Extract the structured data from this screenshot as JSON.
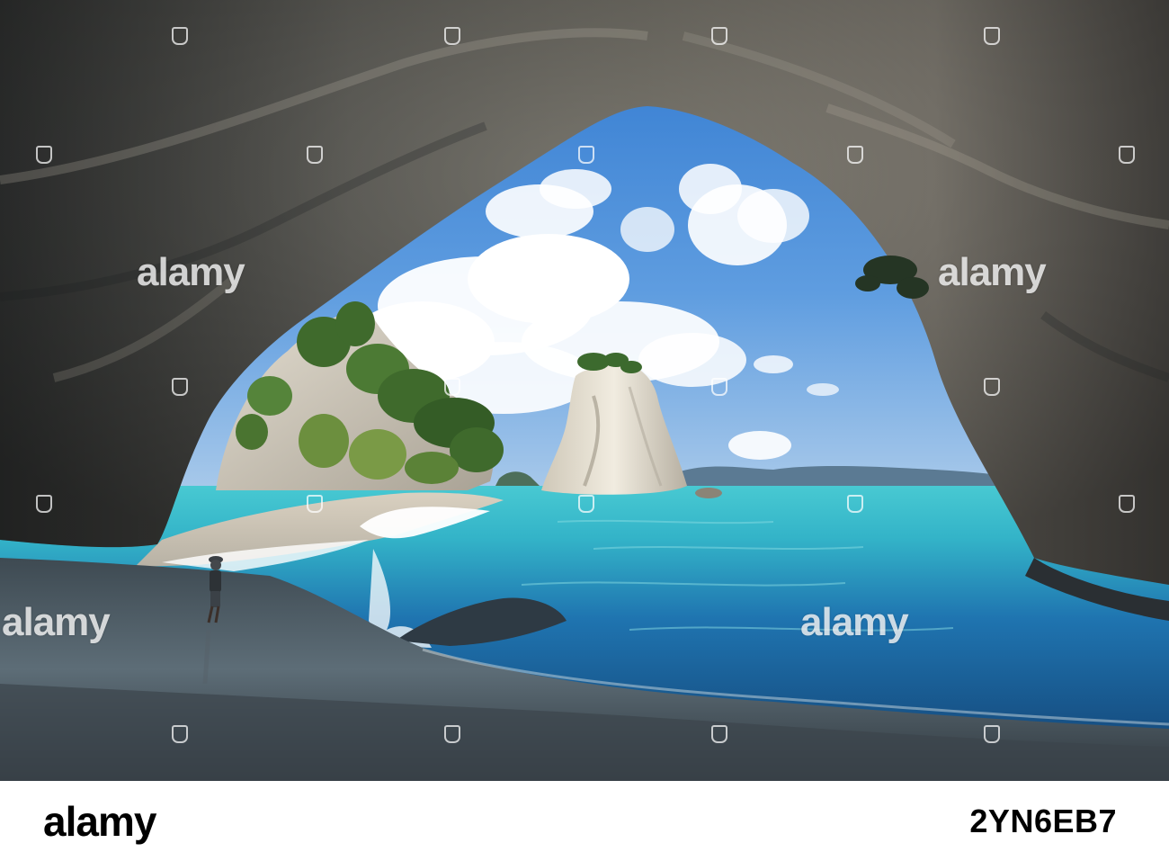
{
  "watermark": {
    "text": "alamy",
    "color": "#ffffff"
  },
  "footer": {
    "logo_text": "alamy",
    "image_id": "2YN6EB7"
  },
  "colors": {
    "rock_dark": "#2a2f33",
    "rock_light": "#8e8d86",
    "sky": "#3c86d8",
    "sea_turquoise": "#3fc4cf",
    "sea_deep": "#1d4d86",
    "sand": "#d8cfbf",
    "wet_sand": "#55646e"
  }
}
